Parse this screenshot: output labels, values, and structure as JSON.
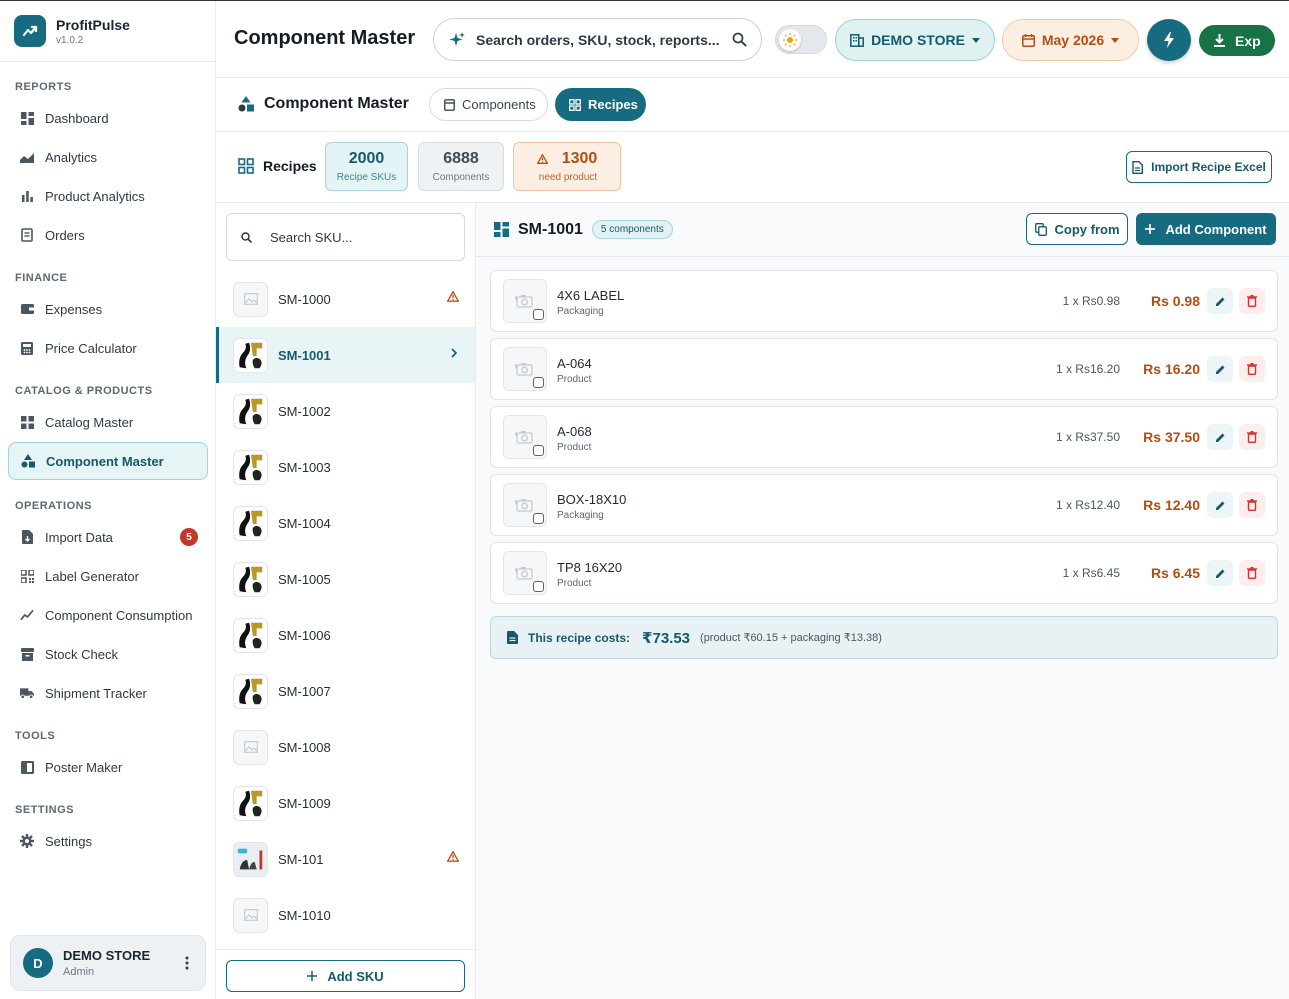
{
  "app": {
    "name": "ProfitPulse",
    "version": "v1.0.2"
  },
  "sidebar": {
    "sections": [
      {
        "label": "REPORTS"
      },
      {
        "label": "FINANCE"
      },
      {
        "label": "CATALOG & PRODUCTS"
      },
      {
        "label": "OPERATIONS"
      },
      {
        "label": "TOOLS"
      },
      {
        "label": "SETTINGS"
      }
    ],
    "items": [
      {
        "label": "Dashboard",
        "icon": "dashboard-icon"
      },
      {
        "label": "Analytics",
        "icon": "analytics-icon"
      },
      {
        "label": "Product Analytics",
        "icon": "bar-chart-icon"
      },
      {
        "label": "Orders",
        "icon": "orders-icon"
      },
      {
        "label": "Expenses",
        "icon": "wallet-icon"
      },
      {
        "label": "Price Calculator",
        "icon": "calculator-icon"
      },
      {
        "label": "Catalog Master",
        "icon": "grid-icon"
      },
      {
        "label": "Component Master",
        "icon": "shapes-icon"
      },
      {
        "label": "Import Data",
        "icon": "file-import-icon",
        "badge": "5"
      },
      {
        "label": "Label Generator",
        "icon": "qrcode-icon"
      },
      {
        "label": "Component Consumption",
        "icon": "trend-icon"
      },
      {
        "label": "Stock Check",
        "icon": "box-icon"
      },
      {
        "label": "Shipment Tracker",
        "icon": "truck-icon"
      },
      {
        "label": "Poster Maker",
        "icon": "poster-icon"
      },
      {
        "label": "Settings",
        "icon": "gear-icon"
      }
    ]
  },
  "user": {
    "initial": "D",
    "name": "DEMO STORE",
    "role": "Admin"
  },
  "header": {
    "title": "Component Master",
    "search_text": "Search orders, SKU, stock, reports...",
    "store": "DEMO STORE",
    "month": "May 2026",
    "export_label": "Exp"
  },
  "subheader": {
    "title": "Component Master",
    "tabs": [
      {
        "label": "Components"
      },
      {
        "label": "Recipes"
      }
    ]
  },
  "stats": {
    "label": "Recipes",
    "recipe_skus": {
      "value": "2000",
      "label": "Recipe SKUs"
    },
    "components": {
      "value": "6888",
      "label": "Components"
    },
    "need_product": {
      "value": "1300",
      "label": "need product"
    },
    "import_label": "Import Recipe Excel"
  },
  "sku_list": {
    "search_placeholder": "Search SKU...",
    "items": [
      {
        "name": "SM-1000",
        "thumb": "placeholder",
        "warn": true
      },
      {
        "name": "SM-1001",
        "thumb": "image",
        "active": true
      },
      {
        "name": "SM-1002",
        "thumb": "image"
      },
      {
        "name": "SM-1003",
        "thumb": "image"
      },
      {
        "name": "SM-1004",
        "thumb": "image"
      },
      {
        "name": "SM-1005",
        "thumb": "image"
      },
      {
        "name": "SM-1006",
        "thumb": "image"
      },
      {
        "name": "SM-1007",
        "thumb": "image"
      },
      {
        "name": "SM-1008",
        "thumb": "placeholder"
      },
      {
        "name": "SM-1009",
        "thumb": "image"
      },
      {
        "name": "SM-101",
        "thumb": "image2",
        "warn": true
      },
      {
        "name": "SM-1010",
        "thumb": "placeholder"
      }
    ],
    "add_label": "Add SKU"
  },
  "detail": {
    "sku": "SM-1001",
    "badge": "5 components",
    "copy_label": "Copy from",
    "add_label": "Add Component",
    "components": [
      {
        "name": "4X6 LABEL",
        "type": "Packaging",
        "qty": "1 x Rs0.98",
        "total": "Rs 0.98"
      },
      {
        "name": "A-064",
        "type": "Product",
        "qty": "1 x Rs16.20",
        "total": "Rs 16.20"
      },
      {
        "name": "A-068",
        "type": "Product",
        "qty": "1 x Rs37.50",
        "total": "Rs 37.50"
      },
      {
        "name": "BOX-18X10",
        "type": "Packaging",
        "qty": "1 x Rs12.40",
        "total": "Rs 12.40"
      },
      {
        "name": "TP8 16X20",
        "type": "Product",
        "qty": "1 x Rs6.45",
        "total": "Rs 6.45"
      }
    ],
    "summary": {
      "label": "This recipe costs:",
      "total": "₹73.53",
      "breakdown": "(product ₹60.15 + packaging ₹13.38)"
    }
  },
  "colors": {
    "primary": "#176b80",
    "accent_orange": "#b14e14",
    "export_green": "#177245",
    "danger": "#c0392b"
  }
}
